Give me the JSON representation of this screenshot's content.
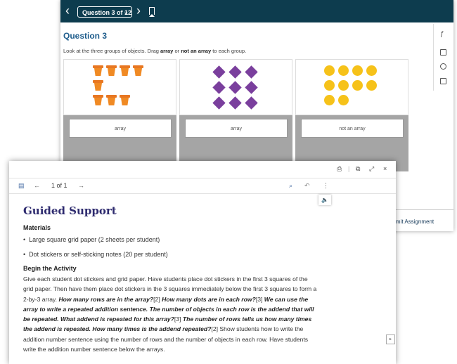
{
  "assessment": {
    "question_selector": "Question 3 of 12",
    "question_title": "Question 3",
    "instruction_pre": "Look at the three groups of objects. Drag ",
    "instruction_word1": "array",
    "instruction_mid": " or ",
    "instruction_word2": "not an array",
    "instruction_post": " to each group.",
    "answers": [
      "array",
      "array",
      "not an array"
    ],
    "submit_label": "ubmit Assignment"
  },
  "guided": {
    "page_count": "1 of 1",
    "title": "Guided Support",
    "materials_heading": "Materials",
    "materials": [
      "Large square grid paper (2 sheets per student)",
      "Dot stickers or self-sticking notes (20 per student)"
    ],
    "activity_heading": "Begin the Activity",
    "activity": {
      "p1": "Give each student dot stickers and grid paper. Have students place dot stickers in the first 3 squares of the grid paper. Then have them place dot stickers in the 3 squares immediately below the first 3 squares to form a 2-by-3 array. ",
      "q1": "How many rows are in the array?",
      "r1": "[2] ",
      "q2": "How many dots are in each row?",
      "r2": "[3] ",
      "q3": "We can use the array to write a repeated addition sentence. The number of objects in each row is the addend that will be repeated. What addend is repeated for this array?",
      "r3": "[3] ",
      "q4": "The number of rows tells us how many times the addend is repeated. How many times is the addend repeated?",
      "r4": "[2] ",
      "p2": "Show students how to write the addition number sentence using the number of rows and the number of objects in each row. Have students write the addition number sentence below the arrays."
    }
  },
  "colors": {
    "topbar": "#0d3c4e",
    "title_blue": "#1f5d8c",
    "pot_orange": "#f08a24",
    "diamond_purple": "#7a3f9d",
    "dot_yellow": "#f6c21a",
    "guided_title": "#2d2a6e"
  }
}
